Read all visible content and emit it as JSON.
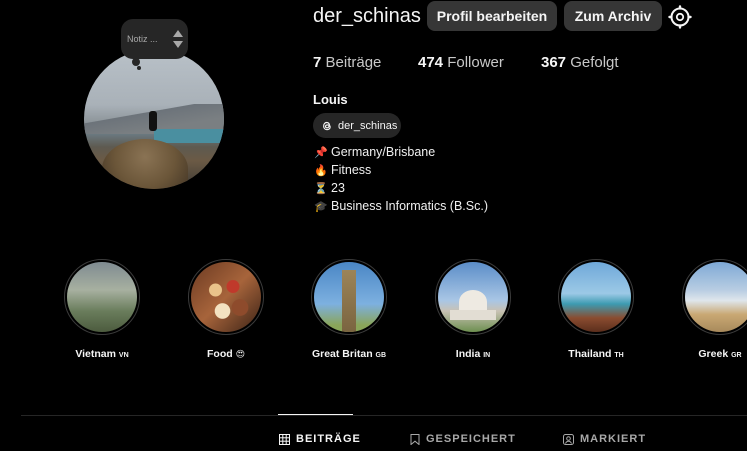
{
  "profile": {
    "username": "der_schinas",
    "edit_label": "Profil bearbeiten",
    "archive_label": "Zum Archiv",
    "note_text": "Notiz ...",
    "stats": {
      "posts_count": "7",
      "posts_label": "Beiträge",
      "followers_count": "474",
      "followers_label": "Follower",
      "following_count": "367",
      "following_label": "Gefolgt"
    },
    "full_name": "Louis",
    "threads_handle": "der_schinas",
    "bio": [
      {
        "emoji": "📌",
        "text": "Germany/Brisbane"
      },
      {
        "emoji": "🔥",
        "text": "Fitness"
      },
      {
        "emoji": "⏳",
        "text": "23"
      },
      {
        "emoji": "🎓",
        "text": "Business Informatics (B.Sc.)"
      }
    ]
  },
  "highlights": [
    {
      "name": "Vietnam",
      "flag": "VN"
    },
    {
      "name": "Food",
      "flag": "😍"
    },
    {
      "name": "Great Britan",
      "flag": "GB"
    },
    {
      "name": "India",
      "flag": "IN"
    },
    {
      "name": "Thailand",
      "flag": "TH"
    },
    {
      "name": "Greek",
      "flag": "GR"
    }
  ],
  "tabs": {
    "posts": "BEITRÄGE",
    "saved": "GESPEICHERT",
    "tagged": "MARKIERT"
  },
  "colors": {
    "background": "#000000",
    "button": "#363636",
    "muted_text": "#a8a8a8"
  }
}
